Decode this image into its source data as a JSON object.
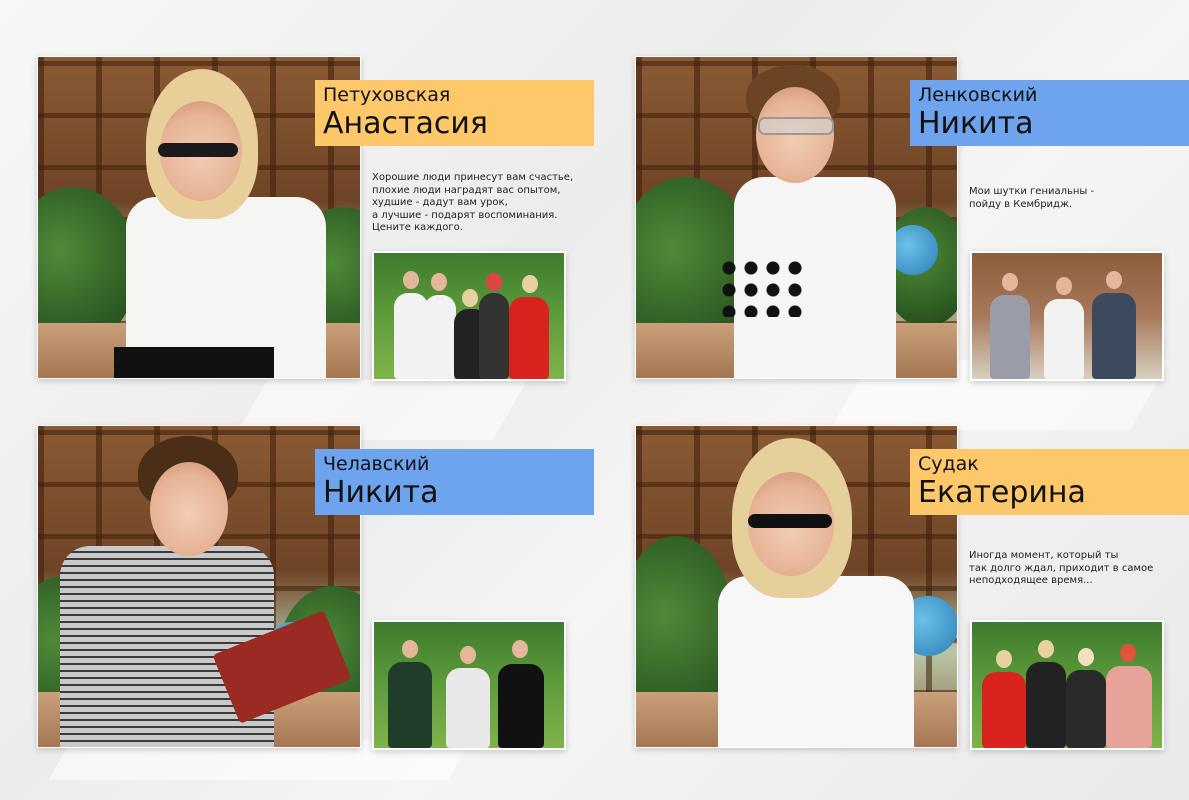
{
  "colors": {
    "orange": "#fcc86a",
    "blue": "#6ea4ee"
  },
  "students": [
    {
      "surname": "Петуховская",
      "firstname": "Анастасия",
      "quote": "Хорошие люди принесут вам счастье,\nплохие люди наградят вас опытом,\nхудшие - дадут вам урок,\nа лучшие - подарят воспоминания.\nЦените каждого.",
      "label_color": "orange"
    },
    {
      "surname": "Ленковский",
      "firstname": "Никита",
      "quote": "Мои шутки гениальны -\nпойду в Кембридж.",
      "label_color": "blue"
    },
    {
      "surname": "Челавский",
      "firstname": "Никита",
      "quote": "",
      "label_color": "blue"
    },
    {
      "surname": "Судак",
      "firstname": "Екатерина",
      "quote": "Иногда момент, который ты\nтак долго ждал, приходит в самое\nнеподходящее время...",
      "label_color": "orange"
    }
  ]
}
